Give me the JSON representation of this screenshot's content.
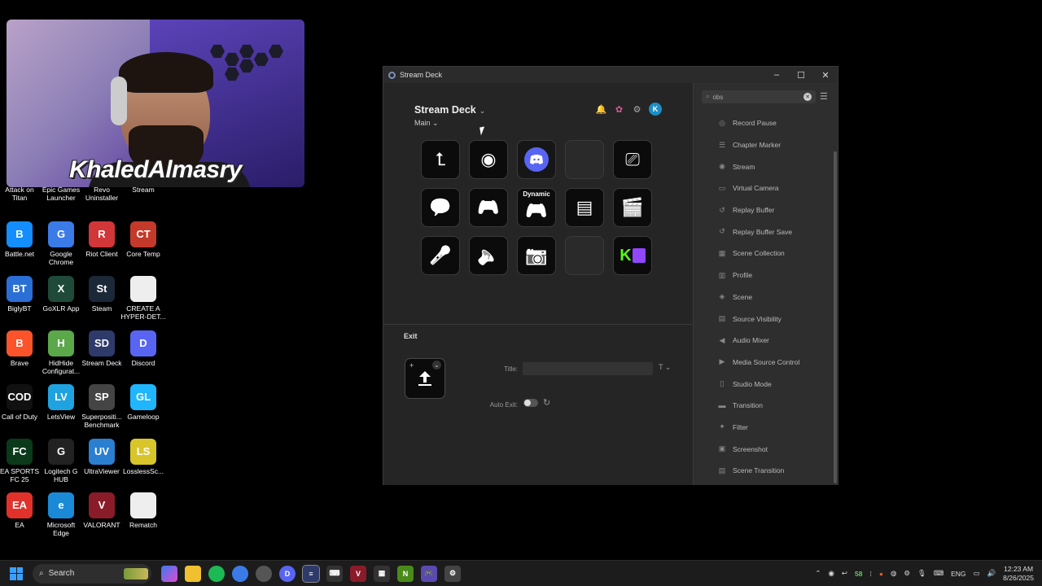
{
  "desktop": {
    "icons": [
      {
        "label": "Attack on\nTitan",
        "color": "#5a3a2a",
        "glyph": "AoT"
      },
      {
        "label": "Epic Games\nLauncher",
        "color": "#222222",
        "glyph": "EG"
      },
      {
        "label": "Revo\nUninstaller",
        "color": "#2b5fa8",
        "glyph": "R"
      },
      {
        "label": "Stream",
        "color": "#333333",
        "glyph": "S"
      },
      {
        "label": "Battle.net",
        "color": "#148eff",
        "glyph": "B"
      },
      {
        "label": "Google\nChrome",
        "color": "#3b7be8",
        "glyph": "G"
      },
      {
        "label": "Riot Client",
        "color": "#d13639",
        "glyph": "R"
      },
      {
        "label": "Core Temp",
        "color": "#c43a2a",
        "glyph": "CT"
      },
      {
        "label": "BiglyBT",
        "color": "#2a6fd6",
        "glyph": "BT"
      },
      {
        "label": "GoXLR App",
        "color": "#1f4a3a",
        "glyph": "X"
      },
      {
        "label": "Steam",
        "color": "#1b2838",
        "glyph": "St"
      },
      {
        "label": "CREATE A\nHYPER-DET...",
        "color": "#eeeeee",
        "glyph": ""
      },
      {
        "label": "Brave",
        "color": "#fb542b",
        "glyph": "B"
      },
      {
        "label": "HidHide\nConfigurat...",
        "color": "#5aa84a",
        "glyph": "H"
      },
      {
        "label": "Stream Deck",
        "color": "#2e3a6a",
        "glyph": "SD"
      },
      {
        "label": "Discord",
        "color": "#5865f2",
        "glyph": "D"
      },
      {
        "label": "Call of Duty",
        "color": "#111111",
        "glyph": "COD"
      },
      {
        "label": "LetsView",
        "color": "#1fa3e0",
        "glyph": "LV"
      },
      {
        "label": "Superpositi...\nBenchmark",
        "color": "#444444",
        "glyph": "SP"
      },
      {
        "label": "Gameloop",
        "color": "#1fb6ff",
        "glyph": "GL"
      },
      {
        "label": "EA SPORTS\nFC 25",
        "color": "#0a3a1a",
        "glyph": "FC"
      },
      {
        "label": "Logitech G\nHUB",
        "color": "#222222",
        "glyph": "G"
      },
      {
        "label": "UltraViewer",
        "color": "#2a7fd0",
        "glyph": "UV"
      },
      {
        "label": "LosslessSc...",
        "color": "#d8c52a",
        "glyph": "LS"
      },
      {
        "label": "EA",
        "color": "#e0322b",
        "glyph": "EA"
      },
      {
        "label": "Microsoft\nEdge",
        "color": "#1a8ad6",
        "glyph": "e"
      },
      {
        "label": "VALORANT",
        "color": "#8a1c2a",
        "glyph": "V"
      },
      {
        "label": "Rematch",
        "color": "#eeeeee",
        "glyph": ""
      }
    ]
  },
  "webcam": {
    "overlay_name": "KhaledAlmasry"
  },
  "window": {
    "title": "Stream Deck",
    "device_name": "Stream Deck",
    "profile": "Main",
    "keys": [
      {
        "icon": "back-arrow-icon",
        "glyph": "⮤",
        "dynamic": ""
      },
      {
        "icon": "record-icon",
        "glyph": "◉",
        "dynamic": ""
      },
      {
        "icon": "discord-icon",
        "glyph": "",
        "dynamic": ""
      },
      {
        "icon": "empty",
        "glyph": "",
        "dynamic": ""
      },
      {
        "icon": "presentation-icon",
        "glyph": "⎚",
        "dynamic": ""
      },
      {
        "icon": "chat-icon",
        "glyph": "💬",
        "dynamic": ""
      },
      {
        "icon": "gamepad-icon",
        "glyph": "🎮",
        "dynamic": ""
      },
      {
        "icon": "gamepad-dynamic-icon",
        "glyph": "🎮",
        "dynamic": "Dynamic"
      },
      {
        "icon": "folder-icon",
        "glyph": "▤",
        "dynamic": ""
      },
      {
        "icon": "clapperboard-icon",
        "glyph": "🎬",
        "dynamic": ""
      },
      {
        "icon": "microphone-icon",
        "glyph": "🎤",
        "dynamic": ""
      },
      {
        "icon": "speaker-icon",
        "glyph": "🔈",
        "dynamic": ""
      },
      {
        "icon": "camera-icon",
        "glyph": "📷",
        "dynamic": ""
      },
      {
        "icon": "empty",
        "glyph": "",
        "dynamic": ""
      },
      {
        "icon": "kick-twitch-icon",
        "glyph": "K",
        "dynamic": ""
      }
    ],
    "exit_label": "Exit",
    "title_field_label": "Title:",
    "title_field_value": "",
    "auto_exit_label": "Auto Exit:",
    "search_value": "obs",
    "actions": [
      {
        "label": "Record Pause",
        "icon": "◎"
      },
      {
        "label": "Chapter Marker",
        "icon": "☰"
      },
      {
        "label": "Stream",
        "icon": "◉"
      },
      {
        "label": "Virtual Camera",
        "icon": "▭"
      },
      {
        "label": "Replay Buffer",
        "icon": "↺"
      },
      {
        "label": "Replay Buffer Save",
        "icon": "↺"
      },
      {
        "label": "Scene Collection",
        "icon": "▦"
      },
      {
        "label": "Profile",
        "icon": "▥"
      },
      {
        "label": "Scene",
        "icon": "◈"
      },
      {
        "label": "Source Visibility",
        "icon": "▤"
      },
      {
        "label": "Audio Mixer",
        "icon": "◀"
      },
      {
        "label": "Media Source Control",
        "icon": "▶"
      },
      {
        "label": "Studio Mode",
        "icon": "▯"
      },
      {
        "label": "Transition",
        "icon": "▬"
      },
      {
        "label": "Filter",
        "icon": "✦"
      },
      {
        "label": "Screenshot",
        "icon": "▣"
      },
      {
        "label": "Scene Transition",
        "icon": "▤"
      }
    ]
  },
  "taskbar": {
    "search_label": "Search",
    "tray_number": "58",
    "language": "ENG",
    "time": "12:23 AM",
    "date": "8/26/2025"
  }
}
